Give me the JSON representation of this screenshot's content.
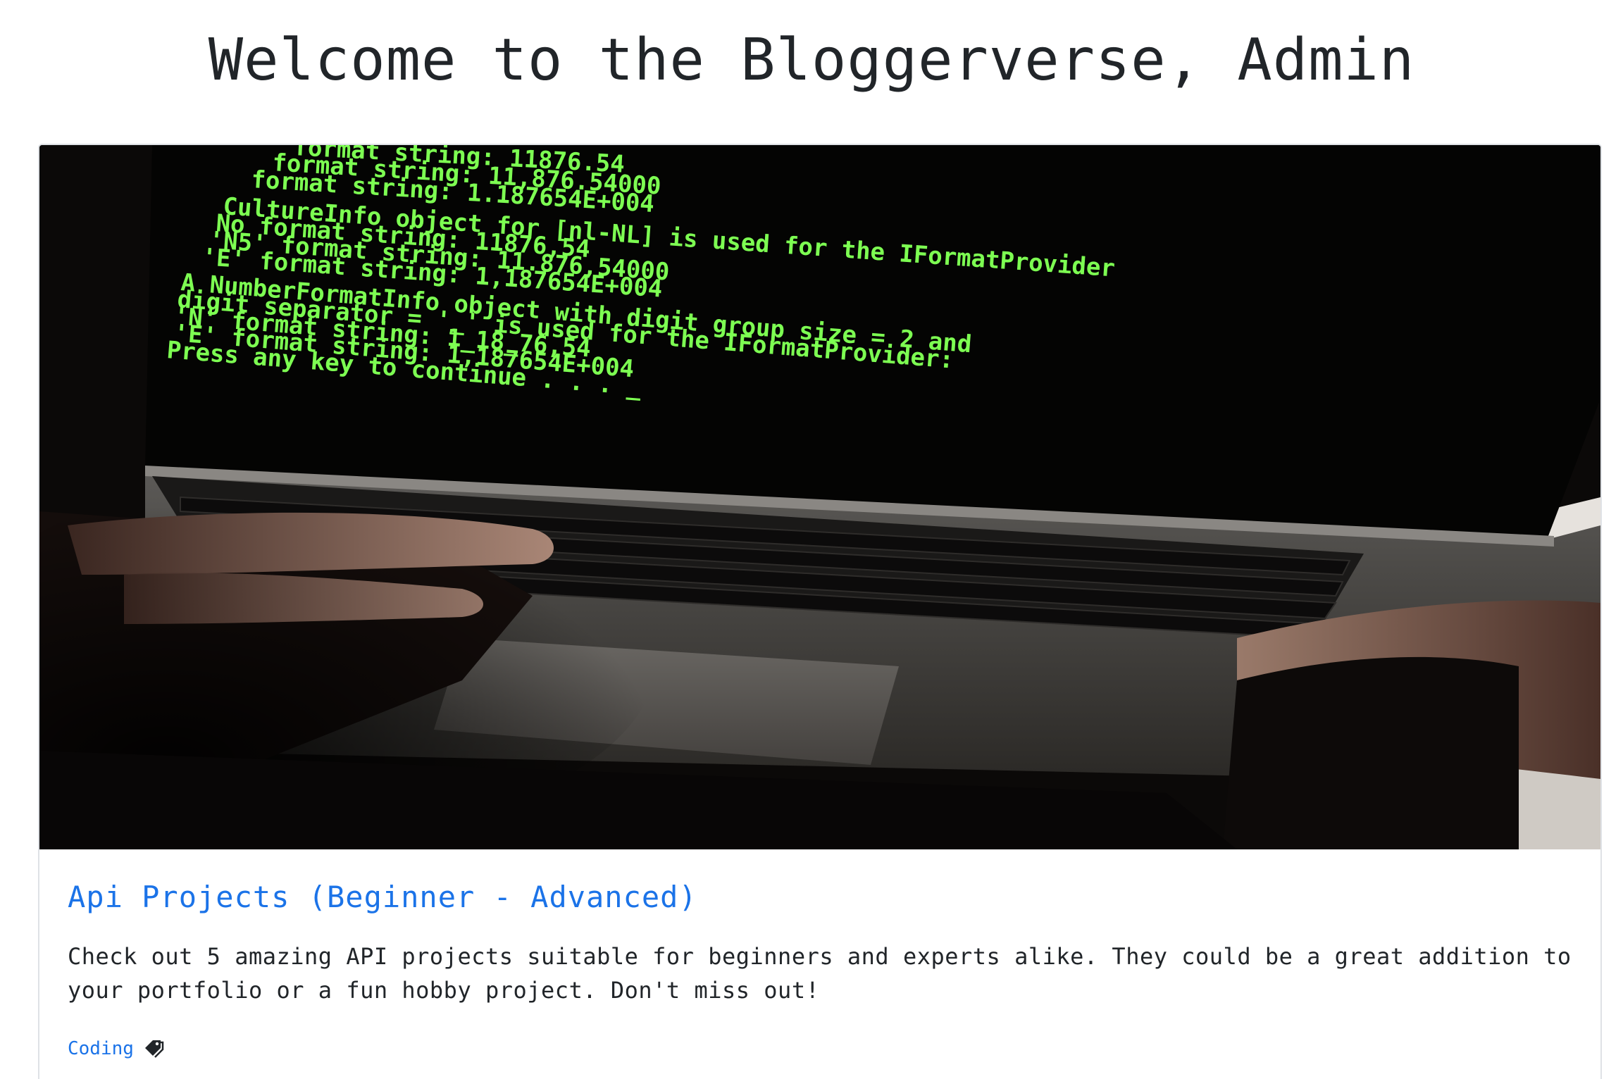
{
  "header": {
    "title": "Welcome to the Bloggerverse, Admin"
  },
  "post": {
    "title": "Api Projects (Beginner - Advanced)",
    "excerpt": "Check out 5 amazing API projects suitable for beginners and experts alike. They could be a great addition to your portfolio or a fun hobby project. Don't miss out!",
    "tags": [
      {
        "label": "Coding",
        "icon": "tag-icon"
      }
    ],
    "image": {
      "description_icon": "laptop-code-photo",
      "screen_lines": [
        "format string:         11876.54",
        "format string:         11,876.54000",
        "format string:         1.187654E+004",
        "CultureInfo object for [nl-NL] is used for the IFormatProvider",
        "No format string:      11876,54",
        "'N5' format string:    11.876,54000",
        "'E' format string:     1,187654E+004",
        "A NumberFormatInfo object with digit group size = 2 and",
        "digit separator = '_' is used for the IFormatProvider:",
        "'N' format string:     1_18_76,54",
        "'E' format string:     1,187654E+004",
        "Press any key to continue . . . _"
      ]
    }
  },
  "colors": {
    "link": "#1b73e8",
    "text": "#212529",
    "border": "#dfe2e6",
    "terminal_green": "#7dff52"
  }
}
